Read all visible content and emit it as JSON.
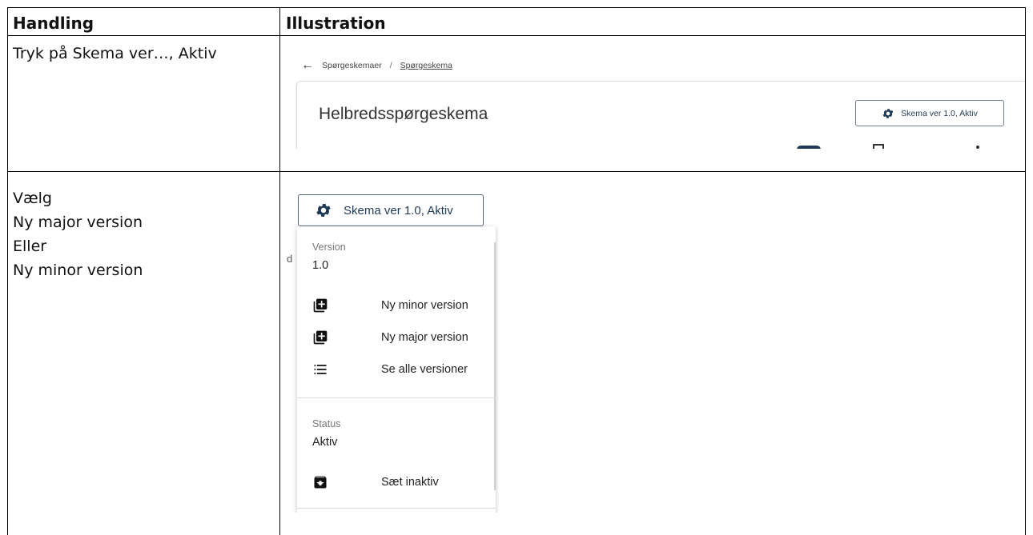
{
  "table": {
    "headers": [
      "Handling",
      "Illustration"
    ],
    "rows": [
      {
        "handling": [
          "Tryk på Skema ver…, Aktiv"
        ]
      },
      {
        "handling": [
          "Vælg",
          "Ny major version",
          "Eller",
          "Ny minor version"
        ]
      }
    ]
  },
  "illustration1": {
    "breadcrumb": {
      "back_icon": "arrow-left-icon",
      "parent": "Spørgeskemaer",
      "separator": "/",
      "current": "Spørgeskema"
    },
    "form_title": "Helbredsspørgeskema",
    "schema_button": {
      "icon": "gear-icon",
      "label": "Skema ver 1.0, Aktiv"
    }
  },
  "illustration2": {
    "schema_button": {
      "icon": "gear-icon",
      "label": "Skema ver 1.0, Aktiv"
    },
    "background_fragment": "d",
    "menu": {
      "version_label": "Version",
      "version_value": "1.0",
      "version_items": [
        {
          "icon": "add-box-icon",
          "label": "Ny minor version"
        },
        {
          "icon": "add-box-icon",
          "label": "Ny major version"
        },
        {
          "icon": "list-icon",
          "label": "Se alle versioner"
        }
      ],
      "status_label": "Status",
      "status_value": "Aktiv",
      "status_items": [
        {
          "icon": "archive-icon",
          "label": "Sæt inaktiv"
        }
      ]
    }
  },
  "colors": {
    "border": "#000000",
    "button_text": "#1f3a55",
    "toggle": "#1f3a55"
  }
}
